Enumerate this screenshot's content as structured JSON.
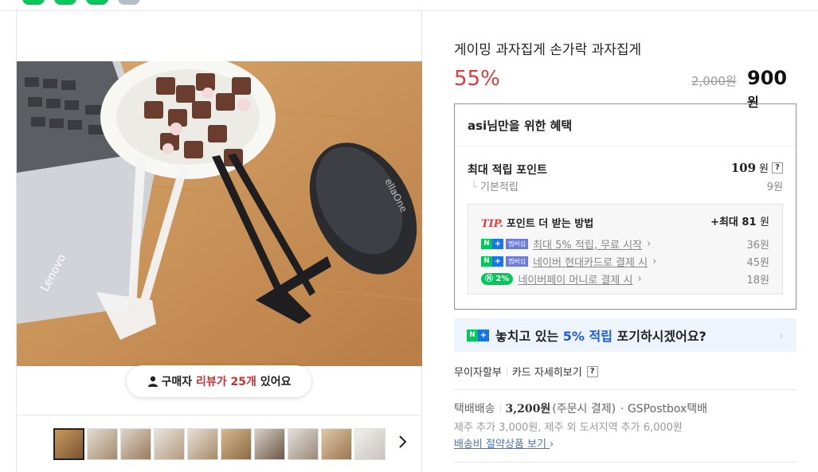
{
  "product": {
    "title": "게이밍 과자집게 손가락 과자집게",
    "discount": "55%",
    "original_price": "2,000원",
    "sale_price": "900",
    "sale_unit": "원"
  },
  "gallery": {
    "review_prefix": "구매자",
    "review_count_text": "리뷰가 25개",
    "review_suffix": "있어요",
    "next_label": "›"
  },
  "benefit": {
    "header": "asi님만을 위한 혜택",
    "max_points_label": "최대 적립 포인트",
    "max_points_value": "109",
    "max_points_unit": "원",
    "help": "?",
    "basic_label": "기본적립",
    "basic_value": "9원",
    "tip_label": "TIP.",
    "tip_title": "포인트 더 받는 방법",
    "tip_max_prefix": "+최대 81",
    "tip_max_unit": "원",
    "membership_tag": "멤버십",
    "pct_badge": "2%",
    "tips": [
      {
        "text": "최대 5% 적립, 무료 시작",
        "amount": "36원"
      },
      {
        "text": "네이버 현대카드로 결제 시",
        "amount": "45원"
      },
      {
        "text": "네이버페이 머니로 결제 시",
        "amount": "18원"
      }
    ]
  },
  "promo": {
    "pre": "놓치고 있는",
    "highlight": "5% 적립",
    "post": "포기하시겠어요?",
    "chevron": "›"
  },
  "payment": {
    "installment": "무이자할부",
    "card_detail": "카드 자세히보기",
    "help": "?"
  },
  "shipping": {
    "method": "택배배송",
    "price": "3,200원",
    "pay_type": "(주문시 결제)",
    "carrier": "· GSPostbox택배",
    "extra": "제주 추가 3,000원, 제주 외 도서지역 추가 6,000원",
    "link": "배송비 절약상품 보기"
  },
  "colors": {
    "discount_red": "#e03a3e",
    "naver_green": "#03c75a",
    "promo_blue": "#1a5be8"
  }
}
